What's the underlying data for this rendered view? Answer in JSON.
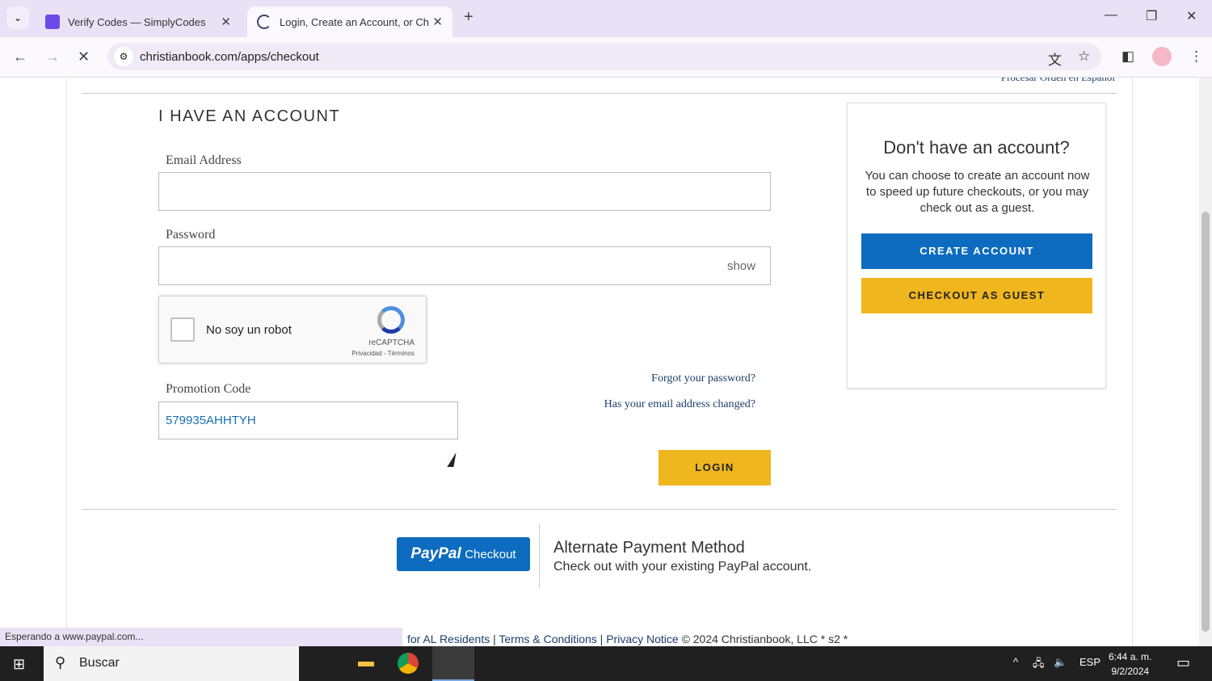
{
  "browser": {
    "tabs": [
      {
        "title": "Verify Codes — SimplyCodes",
        "active": false
      },
      {
        "title": "Login, Create an Account, or Ch",
        "active": true
      }
    ],
    "url": "christianbook.com/apps/checkout",
    "status_text": "Esperando a www.paypal.com..."
  },
  "page": {
    "spanish_link": "Procesar Orden en Español",
    "login": {
      "heading": "I HAVE AN ACCOUNT",
      "email_label": "Email Address",
      "email_value": "",
      "password_label": "Password",
      "password_value": "",
      "show_label": "show",
      "captcha": {
        "label": "No soy un robot",
        "brand": "reCAPTCHA",
        "links": "Privacidad - Términos",
        "checked": false
      },
      "promo_label": "Promotion Code",
      "promo_value": "579935AHHTYH",
      "forgot_link": "Forgot your password?",
      "email_changed_link": "Has your email address changed?",
      "login_button": "LOGIN"
    },
    "signup": {
      "heading": "Don't have an account?",
      "text": "You can choose to create an account now to speed up future checkouts, or you may check out as a guest.",
      "create_button": "CREATE ACCOUNT",
      "guest_button": "CHECKOUT AS GUEST"
    },
    "paypal": {
      "brand": "PayPal",
      "button_suffix": "Checkout",
      "title": "Alternate Payment Method",
      "subtitle": "Check out with your existing PayPal account."
    },
    "footer": {
      "al": "for AL Residents",
      "terms": "Terms & Conditions",
      "privacy": "Privacy Notice",
      "copyright": "© 2024 Christianbook, LLC   * s2 *"
    }
  },
  "taskbar": {
    "search": "Buscar",
    "lang": "ESP",
    "time": "6:44 a. m.",
    "date": "9/2/2024"
  },
  "colors": {
    "blue": "#0d6cbf",
    "gold": "#f0b61e",
    "link": "#1c3e6b"
  }
}
